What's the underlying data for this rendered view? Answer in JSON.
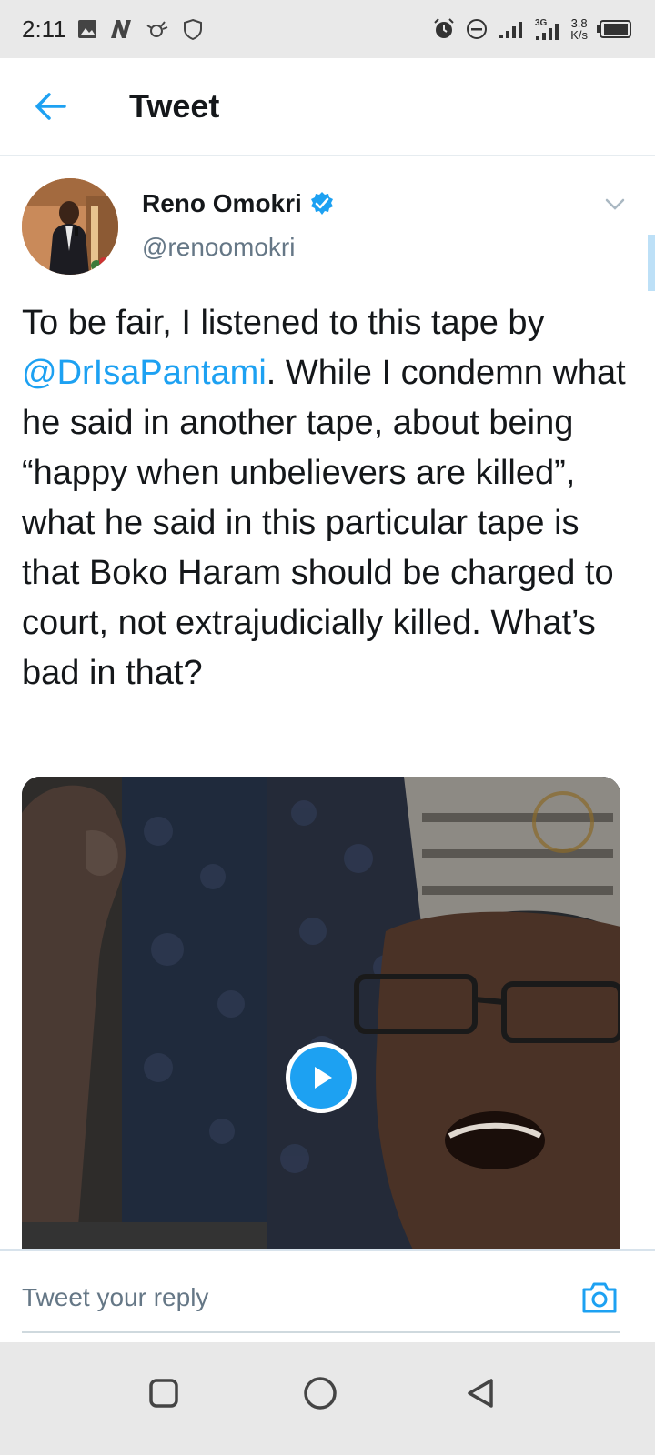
{
  "status_bar": {
    "time": "2:11",
    "net_speed_value": "3.8",
    "net_speed_unit": "K/s",
    "network_type": "3G"
  },
  "header": {
    "title": "Tweet"
  },
  "tweet": {
    "author_name": "Reno Omokri",
    "author_handle": "@renoomokri",
    "text_before_mention": "To be fair, I listened to this tape by ",
    "mention": "@DrIsaPantami",
    "text_after_mention": ". While I condemn what he said in another tape, about being “happy when unbelievers are killed”, what he said in this particular tape is that Boko Haram should be charged to court, not extrajudicially killed. What’s bad in that?"
  },
  "reply": {
    "placeholder": "Tweet your reply"
  },
  "colors": {
    "accent": "#1da1f2",
    "text": "#14171a",
    "secondary_text": "#657786",
    "status_bar_bg": "#e9e9e9",
    "nav_bar_bg": "#e8e8e8"
  },
  "icons": {
    "back": "arrow-left-icon",
    "verified": "verified-badge-icon",
    "more": "chevron-down-icon",
    "play": "play-icon",
    "camera": "camera-icon",
    "nav_recents": "square-icon",
    "nav_home": "circle-icon",
    "nav_back": "triangle-back-icon"
  }
}
